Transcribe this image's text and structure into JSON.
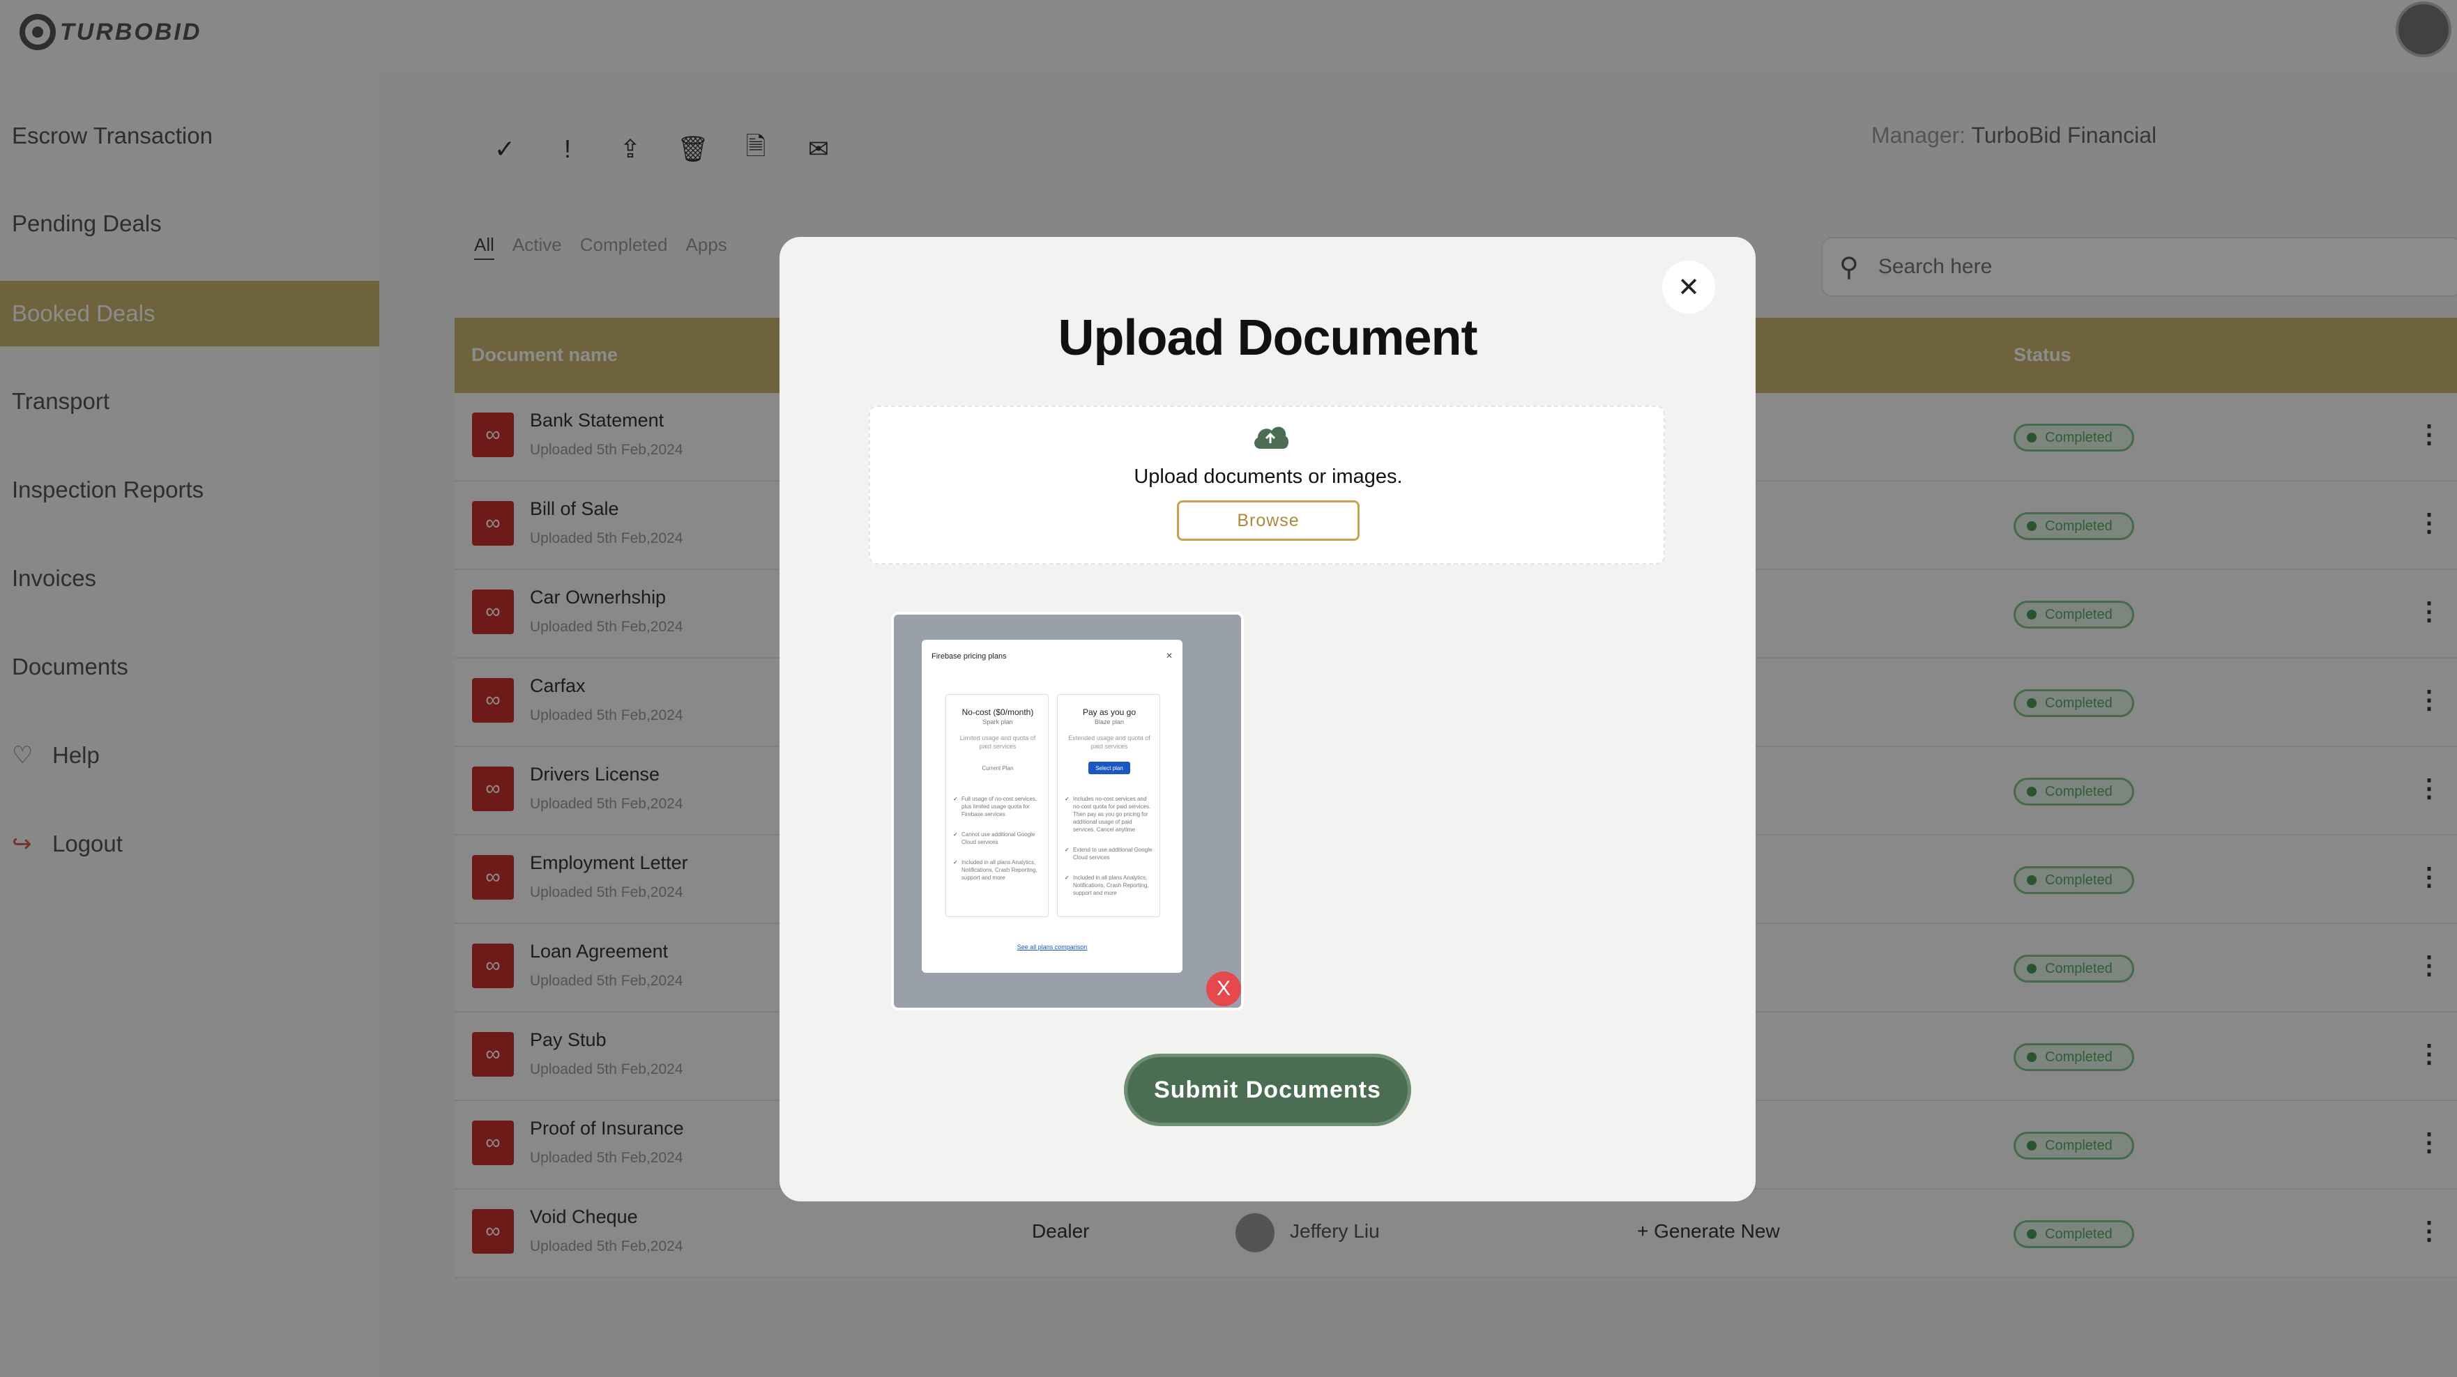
{
  "app": {
    "logo_text": "TURBOBID"
  },
  "sidebar": {
    "items": [
      {
        "label": "Escrow Transaction"
      },
      {
        "label": "Pending Deals"
      },
      {
        "label": "Booked Deals"
      },
      {
        "label": "Transport"
      },
      {
        "label": "Inspection Reports"
      },
      {
        "label": "Invoices"
      },
      {
        "label": "Documents"
      },
      {
        "label": "Help"
      },
      {
        "label": "Logout"
      }
    ]
  },
  "toolbar": {
    "icons": [
      "check-icon",
      "exclamation-icon",
      "upload-icon",
      "trash-icon",
      "file-icon",
      "mail-icon"
    ]
  },
  "manager": {
    "label": "Manager:",
    "name": "TurboBid Financial"
  },
  "filters": {
    "tabs": [
      "All",
      "Active",
      "Completed",
      "Apps"
    ]
  },
  "search": {
    "placeholder": "Search here"
  },
  "table": {
    "headers": {
      "document_name": "Document name",
      "status": "Status"
    },
    "rows": [
      {
        "name": "Bank Statement",
        "date": "Uploaded 5th Feb,2024",
        "status": "Completed"
      },
      {
        "name": "Bill of Sale",
        "date": "Uploaded 5th Feb,2024",
        "status": "Completed"
      },
      {
        "name": "Car Ownerhship",
        "date": "Uploaded 5th Feb,2024",
        "status": "Completed"
      },
      {
        "name": "Carfax",
        "date": "Uploaded 5th Feb,2024",
        "status": "Completed"
      },
      {
        "name": "Drivers License",
        "date": "Uploaded 5th Feb,2024",
        "status": "Completed"
      },
      {
        "name": "Employment Letter",
        "date": "Uploaded 5th Feb,2024",
        "status": "Completed"
      },
      {
        "name": "Loan Agreement",
        "date": "Uploaded 5th Feb,2024",
        "status": "Completed"
      },
      {
        "name": "Pay Stub",
        "date": "Uploaded 5th Feb,2024",
        "status": "Completed"
      },
      {
        "name": "Proof of Insurance",
        "date": "Uploaded 5th Feb,2024",
        "status": "Completed"
      },
      {
        "name": "Void Cheque",
        "date": "Uploaded 5th Feb,2024",
        "status": "Completed",
        "role": "Dealer",
        "user": "Jeffery Liu",
        "action": "+ Generate New"
      }
    ]
  },
  "modal": {
    "title": "Upload Document",
    "drop_text": "Upload documents or images.",
    "browse_label": "Browse",
    "submit_label": "Submit Documents",
    "remove_label": "X",
    "preview": {
      "title": "Firebase pricing plans",
      "plans": [
        {
          "name": "No-cost ($0/month)",
          "sub": "Spark plan",
          "desc": "Limited usage and quota of paid services",
          "button": "Current Plan",
          "features": [
            "Full usage of no-cost services, plus limited usage quota for Firebase services",
            "Cannot use additional Google Cloud services",
            "Included in all plans Analytics, Notifications, Crash Reporting, support and more"
          ]
        },
        {
          "name": "Pay as you go",
          "sub": "Blaze plan",
          "desc": "Extended usage and quota of paid services",
          "button": "Select plan",
          "features": [
            "Includes no-cost services and no-cost quota for paid services. Then pay as you go pricing for additional usage of paid services. Cancel anytime",
            "Extend to use additional Google Cloud services",
            "Included in all plans Analytics, Notifications, Crash Reporting, support and more"
          ]
        }
      ],
      "link": "See all plans comparison"
    }
  },
  "colors": {
    "accent": "#c8b46e",
    "submit": "#4b6e52",
    "status_green": "#5aa867",
    "remove_red": "#e5484d"
  }
}
